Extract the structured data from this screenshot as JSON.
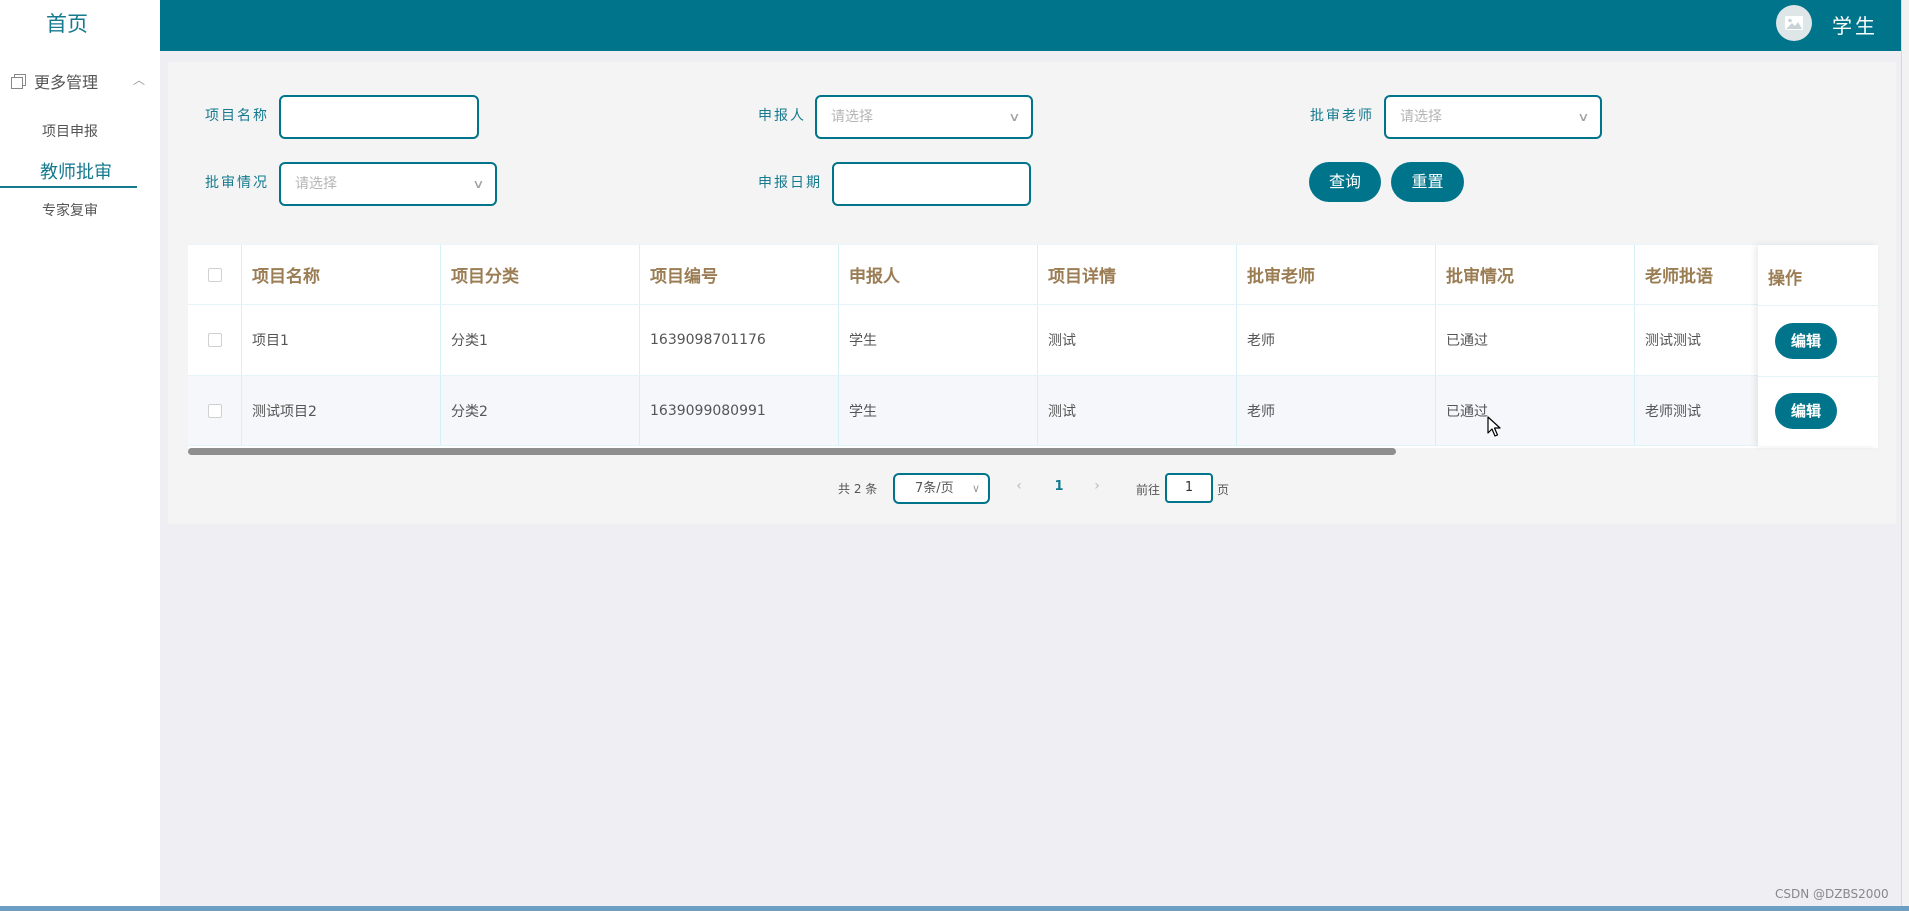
{
  "sidebar": {
    "home": "首页",
    "group_label": "更多管理",
    "items": [
      {
        "label": "项目申报"
      },
      {
        "label": "教师批审"
      },
      {
        "label": "专家复审"
      }
    ]
  },
  "header": {
    "user_name": "学生"
  },
  "search": {
    "project_name_label": "项目名称",
    "project_name_value": "",
    "applicant_label": "申报人",
    "applicant_placeholder": "请选择",
    "teacher_label": "批审老师",
    "teacher_placeholder": "请选择",
    "status_label": "批审情况",
    "status_placeholder": "请选择",
    "date_label": "申报日期",
    "date_value": "",
    "query_button": "查询",
    "reset_button": "重置"
  },
  "table": {
    "columns": [
      "项目名称",
      "项目分类",
      "项目编号",
      "申报人",
      "项目详情",
      "批审老师",
      "批审情况",
      "老师批语",
      "操作"
    ],
    "rows": [
      {
        "name": "项目1",
        "category": "分类1",
        "code": "1639098701176",
        "applicant": "学生",
        "detail": "测试",
        "teacher": "老师",
        "status": "已通过",
        "comment": "测试测试",
        "action": "编辑"
      },
      {
        "name": "测试项目2",
        "category": "分类2",
        "code": "1639099080991",
        "applicant": "学生",
        "detail": "测试",
        "teacher": "老师",
        "status": "已通过",
        "comment": "老师测试",
        "action": "编辑"
      }
    ]
  },
  "pagination": {
    "total": "共 2 条",
    "page_size": "7条/页",
    "current_page": "1",
    "goto_label": "前往",
    "goto_value": "1",
    "page_unit": "页"
  },
  "watermark": "CSDN @DZBS2000",
  "colors": {
    "primary": "#00748a",
    "header_text": "#9b7d54"
  }
}
